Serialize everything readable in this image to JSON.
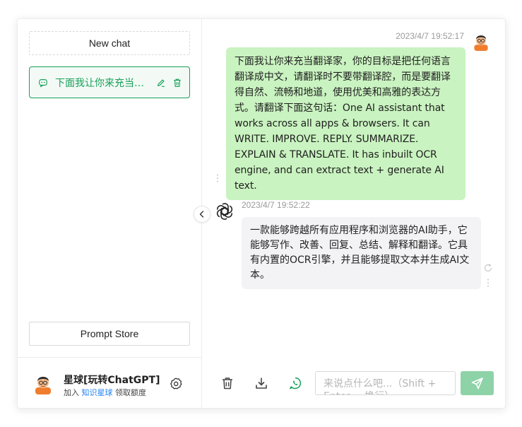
{
  "sidebar": {
    "new_chat_label": "New chat",
    "conversations": [
      {
        "title": "下面我让你来充当翻译家，你的目标是把任何语言翻译成中文"
      }
    ],
    "prompt_store_label": "Prompt Store",
    "user": {
      "name": "星球[玩转ChatGPT]",
      "desc_prefix": "加入 ",
      "desc_link": "知识星球",
      "desc_suffix": " 领取额度"
    }
  },
  "chat": {
    "messages": [
      {
        "role": "user",
        "time": "2023/4/7 19:52:17",
        "text": "下面我让你来充当翻译家，你的目标是把任何语言翻译成中文，请翻译时不要带翻译腔，而是要翻译得自然、流畅和地道，使用优美和高雅的表达方式。请翻译下面这句话：One AI assistant that works across all apps & browsers. It can WRITE. IMPROVE. REPLY. SUMMARIZE. EXPLAIN & TRANSLATE. It has inbuilt OCR engine, and can extract text + generate AI text."
      },
      {
        "role": "assistant",
        "time": "2023/4/7 19:52:22",
        "text": "一款能够跨越所有应用程序和浏览器的AI助手，它能够写作、改善、回复、总结、解释和翻译。它具有内置的OCR引擎，并且能够提取文本并生成AI文本。"
      }
    ]
  },
  "input": {
    "placeholder": "来说点什么吧...（Shift + Enter = 换行）"
  },
  "colors": {
    "accent": "#18a058",
    "user_bubble": "#c9f3c0",
    "ai_bubble": "#f3f3f5",
    "send_button": "#8ed3a8",
    "link": "#2080f0"
  }
}
